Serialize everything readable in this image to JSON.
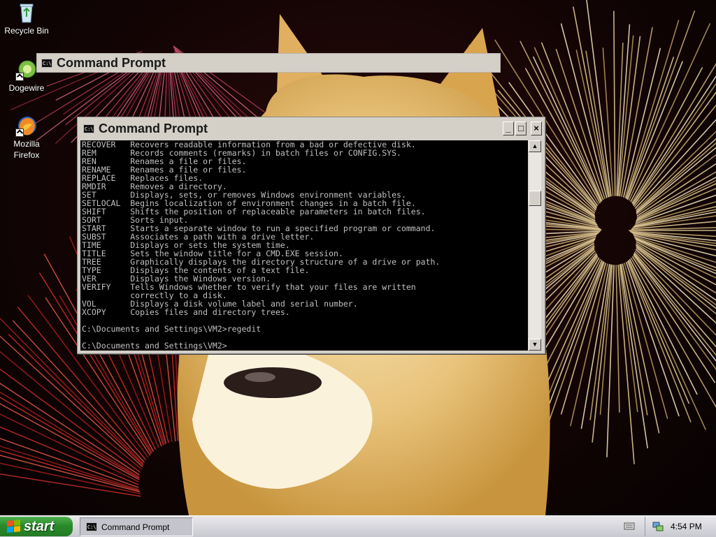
{
  "desktop": {
    "icons": [
      {
        "label": "Recycle Bin",
        "icon": "recycle-bin-icon"
      },
      {
        "label": "Dogewire",
        "icon": "dogewire-icon"
      },
      {
        "label": "Mozilla Firefox",
        "icon": "firefox-icon"
      }
    ],
    "wallpaper": "doge-fireworks"
  },
  "background_window": {
    "title": "Command Prompt",
    "icon": "cmd-icon"
  },
  "cmd_window": {
    "title": "Command Prompt",
    "icon": "cmd-icon",
    "controls": {
      "minimize": "_",
      "maximize": "□",
      "close": "×"
    },
    "console_lines": [
      "RECOVER   Recovers readable information from a bad or defective disk.",
      "REM       Records comments (remarks) in batch files or CONFIG.SYS.",
      "REN       Renames a file or files.",
      "RENAME    Renames a file or files.",
      "REPLACE   Replaces files.",
      "RMDIR     Removes a directory.",
      "SET       Displays, sets, or removes Windows environment variables.",
      "SETLOCAL  Begins localization of environment changes in a batch file.",
      "SHIFT     Shifts the position of replaceable parameters in batch files.",
      "SORT      Sorts input.",
      "START     Starts a separate window to run a specified program or command.",
      "SUBST     Associates a path with a drive letter.",
      "TIME      Displays or sets the system time.",
      "TITLE     Sets the window title for a CMD.EXE session.",
      "TREE      Graphically displays the directory structure of a drive or path.",
      "TYPE      Displays the contents of a text file.",
      "VER       Displays the Windows version.",
      "VERIFY    Tells Windows whether to verify that your files are written",
      "          correctly to a disk.",
      "VOL       Displays a disk volume label and serial number.",
      "XCOPY     Copies files and directory trees.",
      "",
      "C:\\Documents and Settings\\VM2>regedit",
      "",
      "C:\\Documents and Settings\\VM2>"
    ],
    "colors": {
      "console_bg": "#000000",
      "console_fg": "#c0c0c0"
    }
  },
  "taskbar": {
    "start_label": "start",
    "tasks": [
      {
        "label": "Command Prompt",
        "icon": "cmd-icon"
      }
    ],
    "tray": {
      "clock": "4:54 PM",
      "icons": [
        "keyboard-icon",
        "network-icon"
      ]
    },
    "colors": {
      "start": "#2e8b2e"
    }
  }
}
